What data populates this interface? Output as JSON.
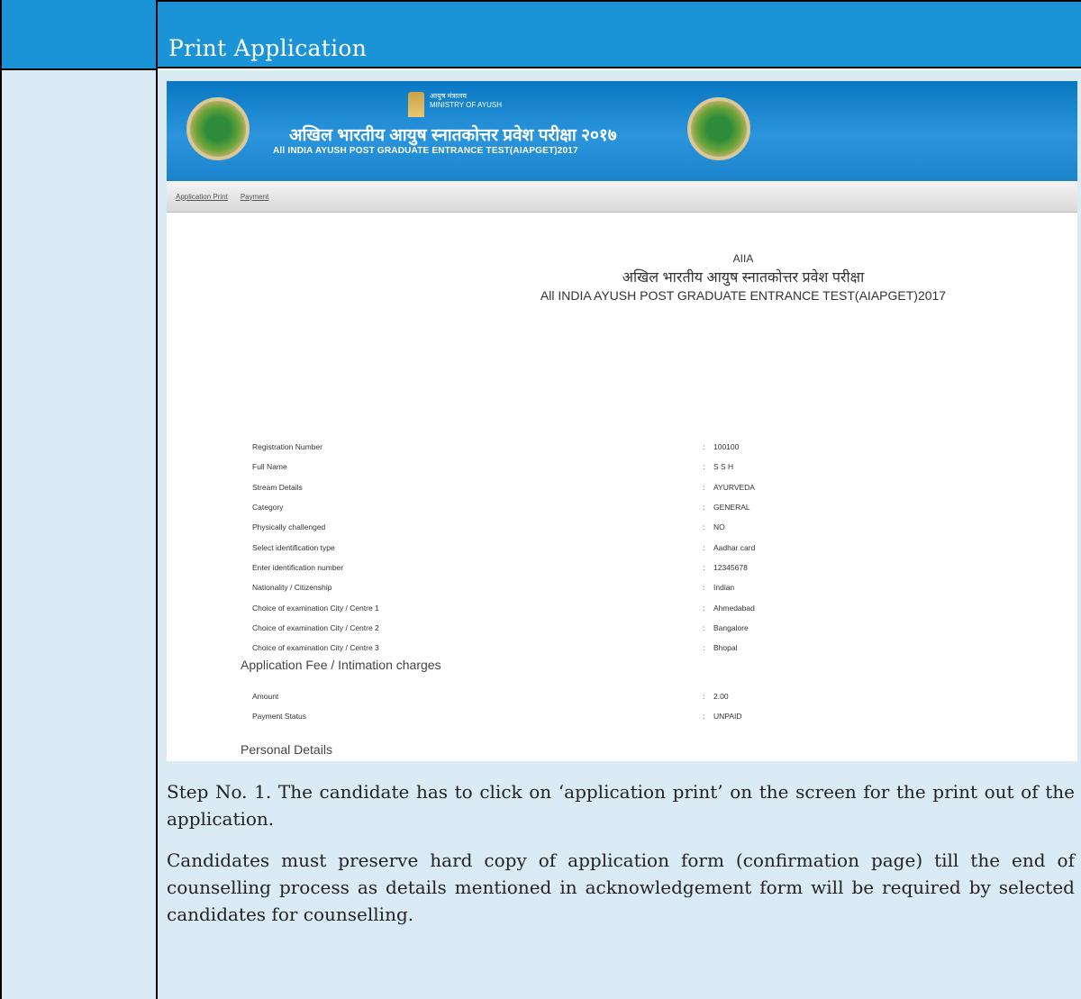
{
  "header": {
    "title": "Print Application"
  },
  "screenshot": {
    "banner": {
      "ministry_hindi": "आयुष मंत्रालय",
      "ministry": "MINISTRY OF AYUSH",
      "title_hindi": "अखिल भारतीय आयुष स्नातकोत्तर प्रवेश परीक्षा २०१७",
      "title_english": "All INDIA AYUSH POST GRADUATE ENTRANCE TEST(AIAPGET)2017"
    },
    "nav": {
      "link1": "Application Print",
      "link2": "Payment"
    },
    "heading": {
      "abbr": "AIIA",
      "hindi": "अखिल भारतीय आयुष स्नातकोत्तर प्रवेश परीक्षा",
      "english": "All INDIA AYUSH POST GRADUATE ENTRANCE TEST(AIAPGET)2017"
    },
    "details": [
      {
        "label": "Registration Number",
        "value": "100100"
      },
      {
        "label": "Full Name",
        "value": "S S H"
      },
      {
        "label": "Stream Details",
        "value": "AYURVEDA"
      },
      {
        "label": "Category",
        "value": "GENERAL"
      },
      {
        "label": "Physically challenged",
        "value": "NO"
      },
      {
        "label": "Select identification type",
        "value": "Aadhar card"
      },
      {
        "label": "Enter identification number",
        "value": "12345678"
      },
      {
        "label": "Nationality / Citizenship",
        "value": "Indian"
      },
      {
        "label": "Choice of examination City / Centre 1",
        "value": "Ahmedabad"
      },
      {
        "label": "Choice of examination City / Centre 2",
        "value": "Bangalore"
      },
      {
        "label": "Choice of examination City / Centre 3",
        "value": "Bhopal"
      }
    ],
    "fee_section": "Application Fee / Intimation charges",
    "fee": [
      {
        "label": "Amount",
        "value": "2.00"
      },
      {
        "label": "Payment Status",
        "value": "UNPAID"
      }
    ],
    "personal_section": "Personal Details",
    "separator": ":"
  },
  "description": {
    "step": "Step No. 1. The candidate has to click on ‘application print’ on the screen for the print out of the application.",
    "note": "Candidates must preserve hard copy of application form (confirmation page) till the end of counselling process as details mentioned in acknowledgement form will be required by selected candidates for counselling."
  }
}
